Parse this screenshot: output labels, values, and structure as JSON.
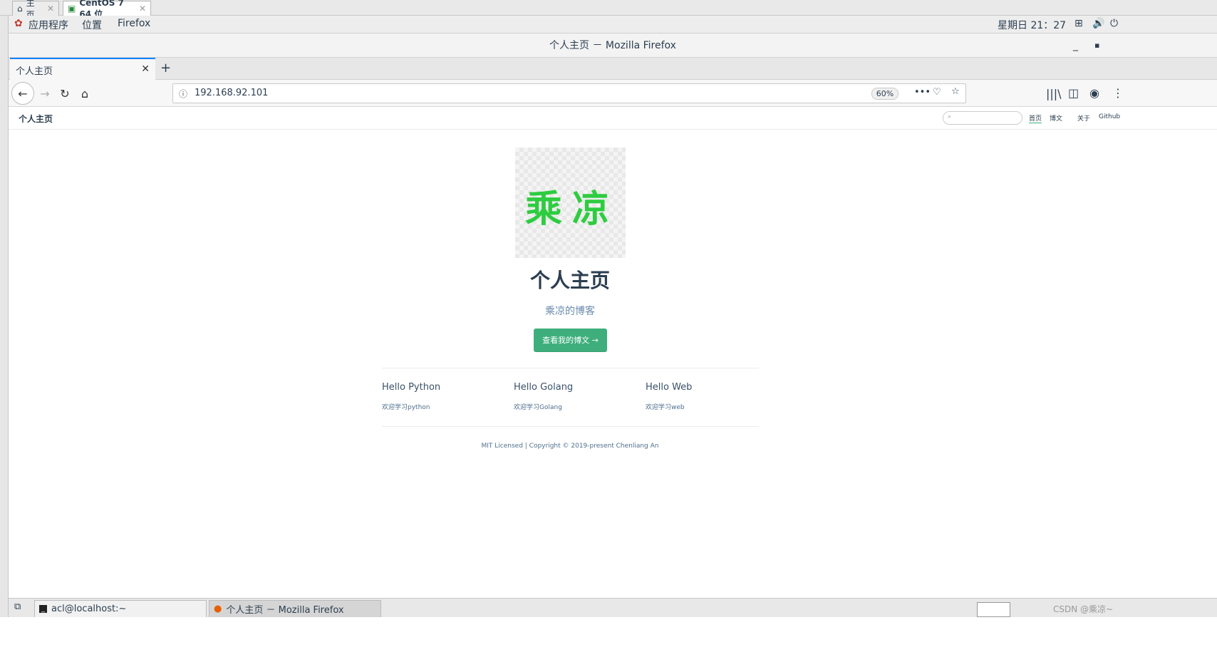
{
  "vm_tabs": [
    {
      "label": "主页",
      "active": false
    },
    {
      "label": "CentOS 7 64 位",
      "active": true
    }
  ],
  "gnome": {
    "apps_menu": "应用程序",
    "places_menu": "位置",
    "firefox_menu": "Firefox",
    "clock": "星期日 21：27"
  },
  "window": {
    "title": "个人主页 － Mozilla Firefox"
  },
  "browser": {
    "tab_title": "个人主页",
    "url": "192.168.92.101",
    "zoom": "60%"
  },
  "site": {
    "title": "个人主页",
    "nav": [
      "首页",
      "博文",
      "关于",
      "Github"
    ],
    "hero_title": "个人主页",
    "hero_desc": "乘凉的博客",
    "hero_image_text": "乘凉",
    "action_text": "查看我的博文 →",
    "features": [
      {
        "title": "Hello Python",
        "details": "欢迎学习python"
      },
      {
        "title": "Hello Golang",
        "details": "欢迎学习Golang"
      },
      {
        "title": "Hello Web",
        "details": "欢迎学习web"
      }
    ],
    "footer": "MIT Licensed | Copyright © 2019-present Chenliang An"
  },
  "taskbar": {
    "terminal": "acl@localhost:~",
    "firefox": "个人主页 － Mozilla Firefox"
  },
  "watermark": "CSDN @乘凉~",
  "colors": {
    "accent": "#3eaf7c",
    "firefox_blue": "#0a84ff"
  }
}
